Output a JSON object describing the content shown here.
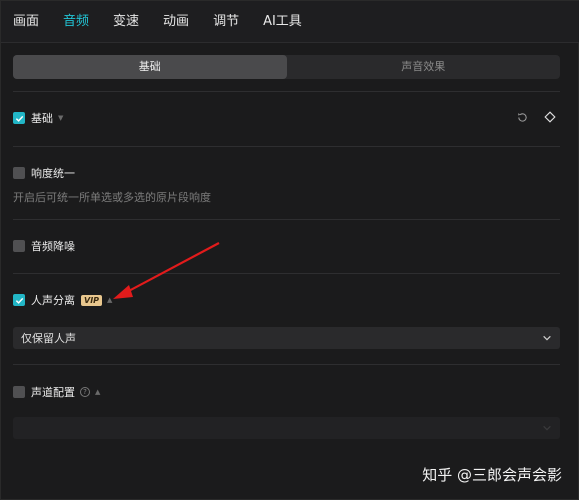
{
  "tabs": [
    "画面",
    "音频",
    "变速",
    "动画",
    "调节",
    "AI工具"
  ],
  "segments": [
    "基础",
    "声音效果"
  ],
  "sections": {
    "basic": {
      "label": "基础",
      "checked": true
    },
    "loudness": {
      "label": "响度统一",
      "checked": false,
      "desc": "开启后可统一所单选或多选的原片段响度"
    },
    "denoise": {
      "label": "音频降噪",
      "checked": false
    },
    "vocal": {
      "label": "人声分离",
      "checked": true,
      "badge": "VIP",
      "select_value": "仅保留人声"
    },
    "channel": {
      "label": "声道配置",
      "checked": false,
      "help": "?"
    }
  },
  "watermark": "知乎 @三郎会声会影",
  "colors": {
    "accent": "#22c6d6",
    "checkbox_on": "#22b6c6",
    "arrow": "#e21b1b"
  },
  "icons": [
    "reset-icon",
    "keyframe-icon",
    "chevron-down-icon",
    "check-icon",
    "help-icon"
  ]
}
